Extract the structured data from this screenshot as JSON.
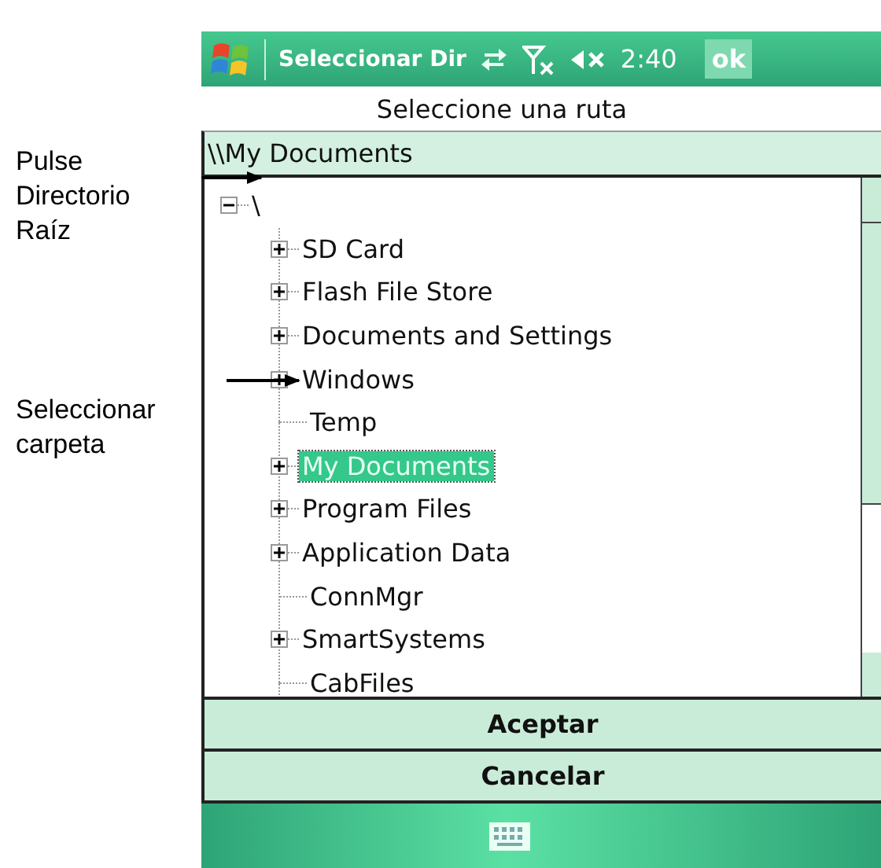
{
  "annotations": [
    {
      "text": "Pulse Directorio Raíz"
    },
    {
      "text": "Seleccionar carpeta"
    }
  ],
  "title_bar": {
    "title": "Seleccionar Dir",
    "time": "2:40",
    "ok": "ok"
  },
  "prompt": "Seleccione una ruta",
  "path": "\\\\My Documents",
  "tree": {
    "label": "\\",
    "expanded": true,
    "selected": false,
    "children": [
      {
        "label": "SD Card",
        "expanded": false,
        "selected": false
      },
      {
        "label": "Flash File Store",
        "expanded": false,
        "selected": false
      },
      {
        "label": "Documents and Settings",
        "expanded": false,
        "selected": false
      },
      {
        "label": "Windows",
        "expanded": false,
        "selected": false
      },
      {
        "label": "Temp",
        "selected": false
      },
      {
        "label": "My Documents",
        "expanded": false,
        "selected": true
      },
      {
        "label": "Program Files",
        "expanded": false,
        "selected": false
      },
      {
        "label": "Application Data",
        "expanded": false,
        "selected": false
      },
      {
        "label": "ConnMgr",
        "selected": false
      },
      {
        "label": "SmartSystems",
        "expanded": false,
        "selected": false
      },
      {
        "label": "CabFiles",
        "selected": false
      }
    ]
  },
  "buttons": [
    "Aceptar",
    "Cancelar"
  ]
}
